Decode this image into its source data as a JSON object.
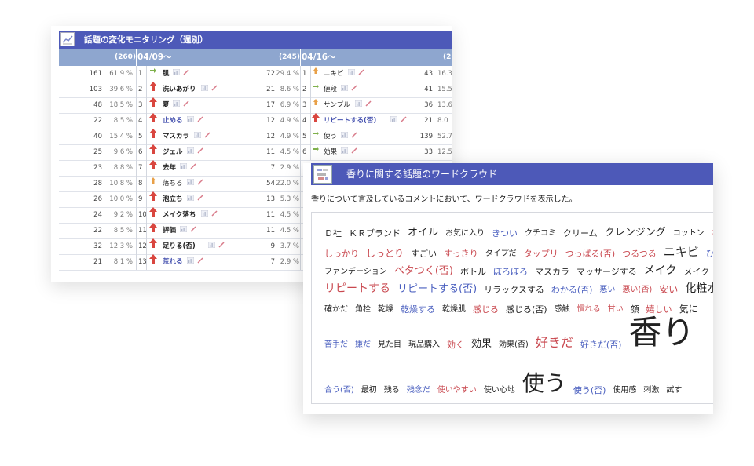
{
  "monitor": {
    "title": "話題の変化モニタリング（週別）",
    "header": {
      "total_a": "(260)",
      "date_a": "04/09～",
      "total_b": "(245)",
      "date_b": "04/16～",
      "total_c": "(26"
    },
    "rows": [
      {
        "a_count": "161",
        "a_pct": "61.9 %",
        "a_rank": "1",
        "a_trend": "flat",
        "a_word": "肌",
        "a_style": "",
        "b_count": "72",
        "b_pct": "29.4 %",
        "b_rank": "1",
        "b_trend": "down",
        "b_word": "ニキビ",
        "b_style": "norm",
        "c_count": "43",
        "c_pct": "16.3"
      },
      {
        "a_count": "103",
        "a_pct": "39.6 %",
        "a_rank": "2",
        "a_trend": "up",
        "a_word": "洗いあがり",
        "a_style": "",
        "b_count": "21",
        "b_pct": "8.6 %",
        "b_rank": "2",
        "b_trend": "flat",
        "b_word": "値段",
        "b_style": "norm",
        "c_count": "41",
        "c_pct": "15.5"
      },
      {
        "a_count": "48",
        "a_pct": "18.5 %",
        "a_rank": "3",
        "a_trend": "up",
        "a_word": "夏",
        "a_style": "",
        "b_count": "17",
        "b_pct": "6.9 %",
        "b_rank": "3",
        "b_trend": "down",
        "b_word": "サンプル",
        "b_style": "norm",
        "c_count": "36",
        "c_pct": "13.6"
      },
      {
        "a_count": "22",
        "a_pct": "8.5 %",
        "a_rank": "4",
        "a_trend": "up",
        "a_word": "止める",
        "a_style": "blue",
        "b_count": "12",
        "b_pct": "4.9 %",
        "b_rank": "4",
        "b_trend": "up",
        "b_word": "リピートする(否)",
        "b_style": "blue",
        "c_count": "21",
        "c_pct": "8.0"
      },
      {
        "a_count": "40",
        "a_pct": "15.4 %",
        "a_rank": "5",
        "a_trend": "up",
        "a_word": "マスカラ",
        "a_style": "",
        "b_count": "12",
        "b_pct": "4.9 %",
        "b_rank": "5",
        "b_trend": "flat",
        "b_word": "使う",
        "b_style": "norm",
        "c_count": "139",
        "c_pct": "52.7"
      },
      {
        "a_count": "25",
        "a_pct": "9.6 %",
        "a_rank": "6",
        "a_trend": "up",
        "a_word": "ジェル",
        "a_style": "",
        "b_count": "11",
        "b_pct": "4.5 %",
        "b_rank": "6",
        "b_trend": "flat",
        "b_word": "効果",
        "b_style": "norm",
        "c_count": "33",
        "c_pct": "12.5"
      },
      {
        "a_count": "23",
        "a_pct": "8.8 %",
        "a_rank": "7",
        "a_trend": "up",
        "a_word": "去年",
        "a_style": "",
        "b_count": "7",
        "b_pct": "2.9 %",
        "b_rank": "",
        "b_trend": "",
        "b_word": "",
        "b_style": "",
        "c_count": "",
        "c_pct": ""
      },
      {
        "a_count": "28",
        "a_pct": "10.8 %",
        "a_rank": "8",
        "a_trend": "down",
        "a_word": "落ちる",
        "a_style": "norm",
        "b_count": "54",
        "b_pct": "22.0 %",
        "b_rank": "",
        "b_trend": "",
        "b_word": "",
        "b_style": "",
        "c_count": "",
        "c_pct": ""
      },
      {
        "a_count": "26",
        "a_pct": "10.0 %",
        "a_rank": "9",
        "a_trend": "up",
        "a_word": "泡立ち",
        "a_style": "",
        "b_count": "13",
        "b_pct": "5.3 %",
        "b_rank": "",
        "b_trend": "",
        "b_word": "",
        "b_style": "",
        "c_count": "",
        "c_pct": ""
      },
      {
        "a_count": "24",
        "a_pct": "9.2 %",
        "a_rank": "10",
        "a_trend": "up",
        "a_word": "メイク落ち",
        "a_style": "",
        "b_count": "11",
        "b_pct": "4.5 %",
        "b_rank": "",
        "b_trend": "",
        "b_word": "",
        "b_style": "",
        "c_count": "",
        "c_pct": ""
      },
      {
        "a_count": "22",
        "a_pct": "8.5 %",
        "a_rank": "11",
        "a_trend": "up",
        "a_word": "評価",
        "a_style": "",
        "b_count": "11",
        "b_pct": "4.5 %",
        "b_rank": "",
        "b_trend": "",
        "b_word": "",
        "b_style": "",
        "c_count": "",
        "c_pct": ""
      },
      {
        "a_count": "32",
        "a_pct": "12.3 %",
        "a_rank": "12",
        "a_trend": "up",
        "a_word": "足りる(否)",
        "a_style": "",
        "b_count": "9",
        "b_pct": "3.7 %",
        "b_rank": "",
        "b_trend": "",
        "b_word": "",
        "b_style": "",
        "c_count": "",
        "c_pct": ""
      },
      {
        "a_count": "21",
        "a_pct": "8.1 %",
        "a_rank": "13",
        "a_trend": "up",
        "a_word": "荒れる",
        "a_style": "blue",
        "b_count": "7",
        "b_pct": "2.9 %",
        "b_rank": "",
        "b_trend": "",
        "b_word": "",
        "b_style": "",
        "c_count": "",
        "c_pct": ""
      }
    ]
  },
  "wordcloud": {
    "title": "香りに関する話題のワードクラウド",
    "description": "香りについて言及しているコメントにおいて、ワードクラウドを表示した。",
    "words": [
      {
        "t": "Ｄ社",
        "c": "k",
        "s": 11
      },
      {
        "t": "ＫＲブランド",
        "c": "k",
        "s": 11
      },
      {
        "t": "オイル",
        "c": "k",
        "s": 13
      },
      {
        "t": "お気に入り",
        "c": "k",
        "s": 10
      },
      {
        "t": "きつい",
        "c": "b",
        "s": 11
      },
      {
        "t": "クチコミ",
        "c": "k",
        "s": 10
      },
      {
        "t": "クリーム",
        "c": "k",
        "s": 11
      },
      {
        "t": "クレンジング",
        "c": "k",
        "s": 13
      },
      {
        "t": "コットン",
        "c": "k",
        "s": 10
      },
      {
        "t": "さ",
        "c": "r",
        "s": 10
      },
      {
        "t": "しっかり",
        "c": "r",
        "s": 11
      },
      {
        "t": "しっとり",
        "c": "r",
        "s": 12
      },
      {
        "t": "すごい",
        "c": "k",
        "s": 11
      },
      {
        "t": "すっきり",
        "c": "r",
        "s": 11
      },
      {
        "t": "タイプだ",
        "c": "k",
        "s": 10
      },
      {
        "t": "タップリ",
        "c": "r",
        "s": 11
      },
      {
        "t": "つっぱる(否)",
        "c": "r",
        "s": 11
      },
      {
        "t": "つるつる",
        "c": "r",
        "s": 11
      },
      {
        "t": "ニキビ",
        "c": "k",
        "s": 15
      },
      {
        "t": "ひ",
        "c": "b",
        "s": 11
      },
      {
        "t": "ファンデーション",
        "c": "k",
        "s": 10
      },
      {
        "t": "ベタつく(否)",
        "c": "r",
        "s": 13
      },
      {
        "t": "ボトル",
        "c": "k",
        "s": 11
      },
      {
        "t": "ぼろぼろ",
        "c": "b",
        "s": 11
      },
      {
        "t": "マスカラ",
        "c": "k",
        "s": 11
      },
      {
        "t": "マッサージする",
        "c": "k",
        "s": 11
      },
      {
        "t": "メイク",
        "c": "k",
        "s": 14
      },
      {
        "t": "メイク",
        "c": "k",
        "s": 11
      },
      {
        "t": "リピートする",
        "c": "r",
        "s": 14
      },
      {
        "t": "リピートする(否)",
        "c": "b",
        "s": 13
      },
      {
        "t": "リラックスする",
        "c": "k",
        "s": 11
      },
      {
        "t": "わかる(否)",
        "c": "b",
        "s": 11
      },
      {
        "t": "悪い",
        "c": "b",
        "s": 10
      },
      {
        "t": "悪い(否)",
        "c": "r",
        "s": 10
      },
      {
        "t": "安い",
        "c": "r",
        "s": 12
      },
      {
        "t": "化粧水",
        "c": "k",
        "s": 14
      },
      {
        "t": "確かだ",
        "c": "k",
        "s": 10
      },
      {
        "t": "角栓",
        "c": "k",
        "s": 10
      },
      {
        "t": "乾燥",
        "c": "k",
        "s": 10
      },
      {
        "t": "乾燥する",
        "c": "b",
        "s": 11
      },
      {
        "t": "乾燥肌",
        "c": "k",
        "s": 10
      },
      {
        "t": "感じる",
        "c": "r",
        "s": 11
      },
      {
        "t": "感じる(否)",
        "c": "k",
        "s": 11
      },
      {
        "t": "感触",
        "c": "k",
        "s": 10
      },
      {
        "t": "慣れる",
        "c": "r",
        "s": 10
      },
      {
        "t": "甘い",
        "c": "r",
        "s": 10
      },
      {
        "t": "顔",
        "c": "k",
        "s": 11
      },
      {
        "t": "嬉しい",
        "c": "r",
        "s": 11
      },
      {
        "t": "気に",
        "c": "k",
        "s": 12
      },
      {
        "t": "苦手だ",
        "c": "b",
        "s": 10
      },
      {
        "t": "嫌だ",
        "c": "b",
        "s": 10
      },
      {
        "t": "見た目",
        "c": "k",
        "s": 10
      },
      {
        "t": "現品購入",
        "c": "k",
        "s": 10
      },
      {
        "t": "効く",
        "c": "r",
        "s": 11
      },
      {
        "t": "効果",
        "c": "k",
        "s": 13
      },
      {
        "t": "効果(否)",
        "c": "k",
        "s": 10
      },
      {
        "t": "好きだ",
        "c": "r",
        "s": 16
      },
      {
        "t": "好きだ(否)",
        "c": "b",
        "s": 11
      },
      {
        "t": "香り",
        "c": "k",
        "s": 42
      },
      {
        "t": "合う(否)",
        "c": "b",
        "s": 10
      },
      {
        "t": "最初",
        "c": "k",
        "s": 10
      },
      {
        "t": "残る",
        "c": "k",
        "s": 10
      },
      {
        "t": "残念だ",
        "c": "b",
        "s": 10
      },
      {
        "t": "使いやすい",
        "c": "r",
        "s": 10
      },
      {
        "t": "使い心地",
        "c": "k",
        "s": 10
      },
      {
        "t": "使う",
        "c": "k",
        "s": 28
      },
      {
        "t": "使う(否)",
        "c": "b",
        "s": 11
      },
      {
        "t": "使用感",
        "c": "k",
        "s": 10
      },
      {
        "t": "刺激",
        "c": "k",
        "s": 10
      },
      {
        "t": "試す",
        "c": "k",
        "s": 10
      }
    ]
  }
}
